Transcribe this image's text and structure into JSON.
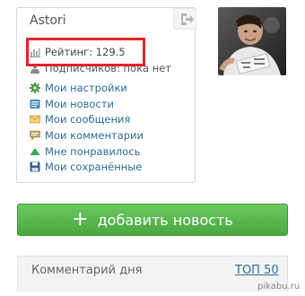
{
  "profile": {
    "username": "Astori",
    "rating": "Рейтинг: 129.5",
    "subscribers": "Подписчиков: пока нет"
  },
  "menu": [
    {
      "label": "Мои настройки",
      "icon": "gear-icon"
    },
    {
      "label": "Мои новости",
      "icon": "news-icon"
    },
    {
      "label": "Мои сообщения",
      "icon": "envelope-icon"
    },
    {
      "label": "Мои комментарии",
      "icon": "comment-icon"
    },
    {
      "label": "Мне понравилось",
      "icon": "thumb-up-icon"
    },
    {
      "label": "Мои сохранённые",
      "icon": "floppy-disk-icon"
    }
  ],
  "actions": {
    "add_news": "добавить новость"
  },
  "comment_of_day": {
    "title": "Комментарий дня",
    "top_link": "ТОП 50"
  },
  "watermark": "pikabu.ru",
  "colors": {
    "link": "#2a6e9a",
    "highlight": "#e0252b",
    "button": "#52b348"
  }
}
